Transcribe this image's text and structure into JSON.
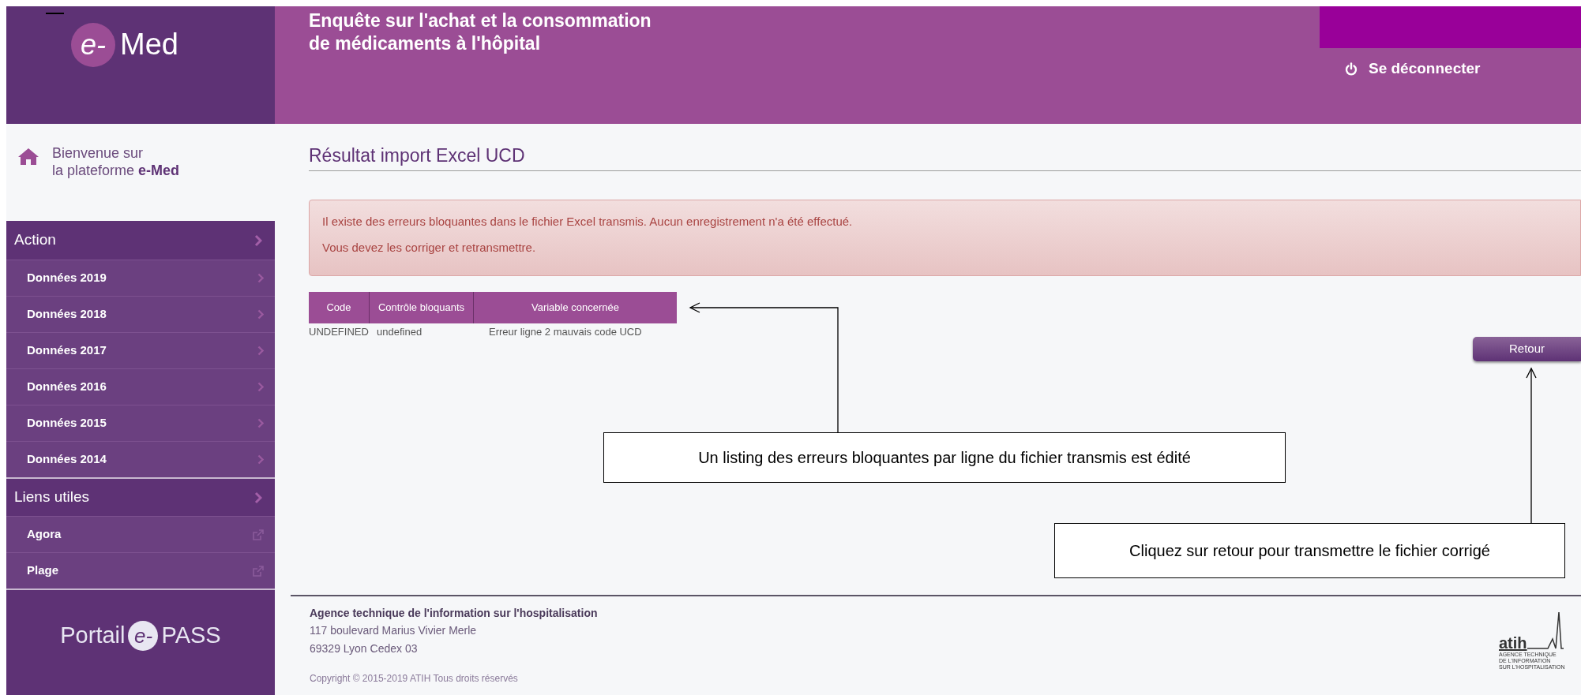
{
  "header": {
    "logo": {
      "badge": "e-",
      "name": "Med"
    },
    "title_lines": [
      "Enquête sur l'achat et la consommation",
      "de médicaments à l'hôpital"
    ],
    "logout": "Se déconnecter"
  },
  "sidebar": {
    "welcome": [
      "Bienvenue sur",
      "la plateforme **e-Med**"
    ],
    "sections": [
      {
        "title": "Action",
        "items": [
          {
            "label": "Données 2019",
            "kind": "internal"
          },
          {
            "label": "Données 2018",
            "kind": "internal"
          },
          {
            "label": "Données 2017",
            "kind": "internal"
          },
          {
            "label": "Données 2016",
            "kind": "internal"
          },
          {
            "label": "Données 2015",
            "kind": "internal"
          },
          {
            "label": "Données 2014",
            "kind": "internal"
          }
        ]
      },
      {
        "title": "Liens utiles",
        "items": [
          {
            "label": "Agora",
            "kind": "external"
          },
          {
            "label": "Plage",
            "kind": "external"
          }
        ]
      }
    ],
    "portal": {
      "prefix": "Portail",
      "badge": "e-",
      "suffix": "PASS"
    }
  },
  "main": {
    "title": "Résultat import Excel UCD",
    "alert": [
      "Il existe des erreurs bloquantes dans le fichier Excel transmis. Aucun enregistrement n'a été effectué.",
      "Vous devez les corriger et retransmettre."
    ],
    "table": {
      "columns": [
        "Code",
        "Contrôle bloquants",
        "Variable concernée"
      ],
      "rows": [
        [
          "UNDEFINED",
          "undefined",
          "Erreur ligne 2 mauvais code UCD"
        ]
      ]
    },
    "back_button": "Retour"
  },
  "annotations": [
    {
      "text": "Un listing des erreurs bloquantes par ligne du fichier transmis est édité",
      "kind": "table"
    },
    {
      "text": "Cliquez sur retour pour transmettre le fichier corrigé",
      "kind": "button"
    }
  ],
  "footer": {
    "organization": "Agence technique de l'information sur l'hospitalisation",
    "address": [
      "117 boulevard Marius Vivier Merle",
      "69329 Lyon Cedex 03"
    ],
    "copyright": "Copyright © 2015-2019 ATIH Tous droits réservés",
    "logo": {
      "name": "atih",
      "caption": [
        "AGENCE TECHNIQUE",
        "DE L'INFORMATION",
        "SUR L'HOSPITALISATION"
      ]
    }
  }
}
